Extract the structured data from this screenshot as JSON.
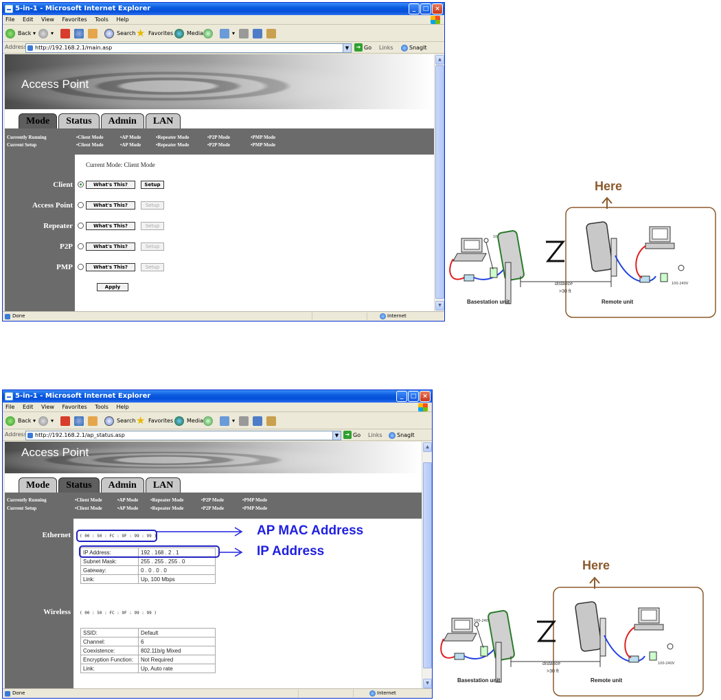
{
  "window": {
    "title": "5-in-1 - Microsoft Internet Explorer",
    "menu": [
      "File",
      "Edit",
      "View",
      "Favorites",
      "Tools",
      "Help"
    ],
    "toolbar": {
      "back": "Back",
      "search": "Search",
      "favorites": "Favorites",
      "media": "Media"
    },
    "address_label": "Address",
    "go_label": "Go",
    "links_label": "Links",
    "snagit_label": "SnagIt",
    "status_done": "Done",
    "status_zone": "Internet"
  },
  "screen1": {
    "url": "http://192.168.2.1/main.asp",
    "banner_title": "Access Point",
    "tabs": [
      "Mode",
      "Status",
      "Admin",
      "LAN"
    ],
    "active_tab": "Mode",
    "currently_running_label": "Currently Running",
    "current_setup_label": "Current Setup",
    "modes": [
      "•Client Mode",
      "•AP Mode",
      "•Repeater Mode",
      "•P2P Mode",
      "•PMP Mode"
    ],
    "current_mode_text": "Current Mode: Client Mode",
    "mode_rows": [
      {
        "label": "Client",
        "selected": true,
        "setup_enabled": true
      },
      {
        "label": "Access Point",
        "selected": false,
        "setup_enabled": false
      },
      {
        "label": "Repeater",
        "selected": false,
        "setup_enabled": false
      },
      {
        "label": "P2P",
        "selected": false,
        "setup_enabled": false
      },
      {
        "label": "PMP",
        "selected": false,
        "setup_enabled": false
      }
    ],
    "whats_this_label": "What's This?",
    "setup_label": "Setup",
    "apply_label": "Apply"
  },
  "screen2": {
    "url": "http://192.168.2.1/ap_status.asp",
    "banner_title": "Access Point",
    "tabs": [
      "Mode",
      "Status",
      "Admin",
      "LAN"
    ],
    "active_tab": "Status",
    "currently_running_label": "Currently Running",
    "current_setup_label": "Current Setup",
    "modes": [
      "•Client Mode",
      "•AP Mode",
      "•Repeater Mode",
      "•P2P Mode",
      "•PMP Mode"
    ],
    "ethernet_label": "Ethernet",
    "ethernet_mac": "( 00 : 50 : FC : 9F : 99 : 99 )",
    "ethernet_rows": [
      {
        "key": "IP Address:",
        "value": "192 . 168 . 2 . 1"
      },
      {
        "key": "Subnet Mask:",
        "value": "255 . 255 . 255 . 0"
      },
      {
        "key": "Gateway:",
        "value": "0 . 0 . 0 . 0"
      },
      {
        "key": "Link:",
        "value": "Up, 100 Mbps"
      }
    ],
    "wireless_label": "Wireless",
    "wireless_mac": "( 00 : 50 : FC : 9F : 99 : 99 )",
    "wireless_rows": [
      {
        "key": "SSID:",
        "value": "Default"
      },
      {
        "key": "Channel:",
        "value": "6"
      },
      {
        "key": "Coexistence:",
        "value": "802.11b/g Mixed"
      },
      {
        "key": "Encryption Function:",
        "value": "Not Required"
      },
      {
        "key": "Link:",
        "value": "Up,  Auto rate"
      }
    ],
    "annotation_mac": "AP MAC Address",
    "annotation_ip": "IP Address"
  },
  "diagram": {
    "here_label": "Here",
    "power_label": "100-240V",
    "distance_label": "distance",
    "distance_value": ">30 ft",
    "basestation_label": "Basestation unit",
    "remote_label": "Remote unit",
    "accent_color": "#8b5a2b"
  }
}
